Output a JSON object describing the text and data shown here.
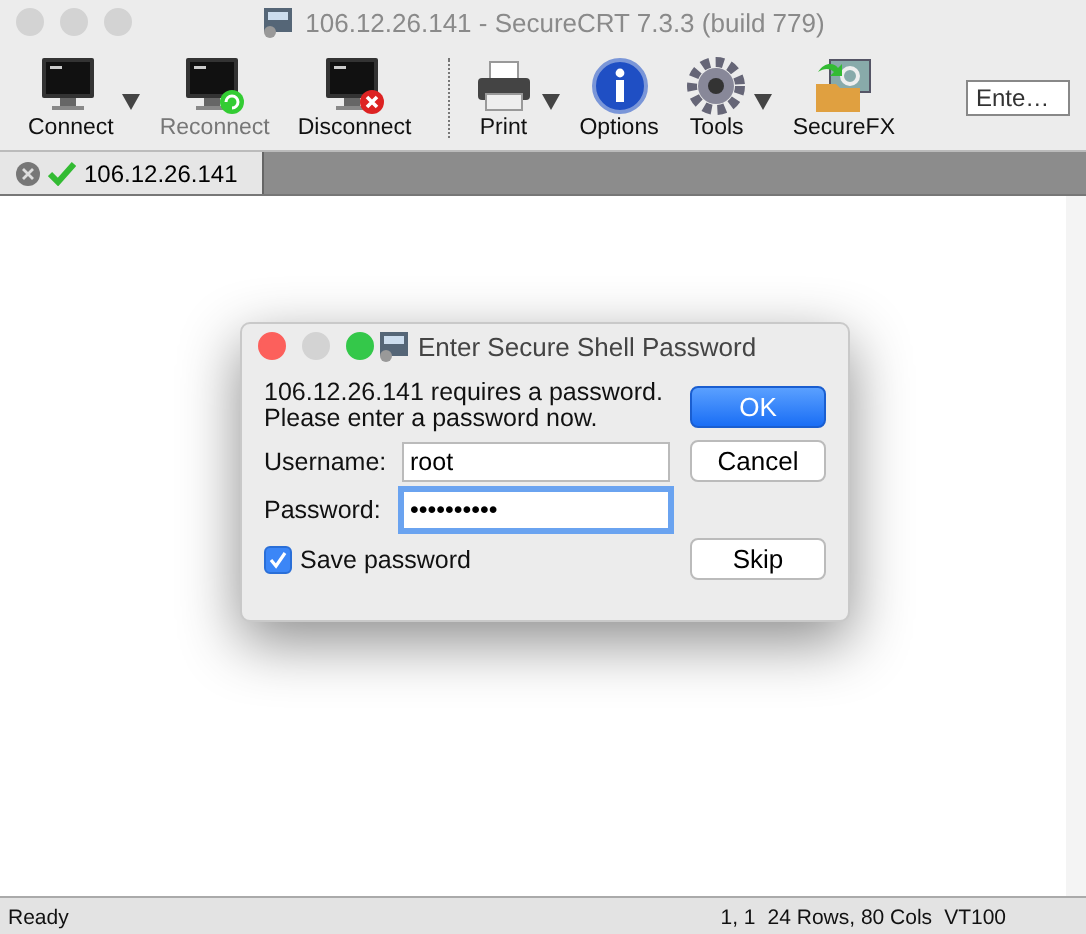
{
  "window": {
    "title": "106.12.26.141 - SecureCRT 7.3.3 (build 779)"
  },
  "toolbar": {
    "items": [
      {
        "kind": "connect",
        "label": "Connect",
        "dropdown": true,
        "disabled": false,
        "separator_after": false
      },
      {
        "kind": "reconnect",
        "label": "Reconnect",
        "dropdown": false,
        "disabled": true,
        "separator_after": false
      },
      {
        "kind": "disconnect",
        "label": "Disconnect",
        "dropdown": false,
        "disabled": false,
        "separator_after": true
      },
      {
        "kind": "print",
        "label": "Print",
        "dropdown": true,
        "disabled": false,
        "separator_after": false
      },
      {
        "kind": "options",
        "label": "Options",
        "dropdown": false,
        "disabled": false,
        "separator_after": false
      },
      {
        "kind": "tools",
        "label": "Tools",
        "dropdown": true,
        "disabled": false,
        "separator_after": false
      },
      {
        "kind": "securefx",
        "label": "SecureFX",
        "dropdown": false,
        "disabled": false,
        "separator_after": false
      }
    ],
    "search": {
      "placeholder": "Ente…"
    }
  },
  "tabs": [
    {
      "label": "106.12.26.141",
      "selected": true,
      "connected": true
    }
  ],
  "dialog": {
    "title": "Enter Secure Shell Password",
    "message": "106.12.26.141 requires a password.\nPlease enter a password now.",
    "fields": [
      {
        "label": "Username:",
        "value": "root",
        "focused": false
      },
      {
        "label": "Password:",
        "value": "••••••••••",
        "focused": true
      }
    ],
    "save_password": {
      "label": "Save password",
      "checked": true
    },
    "buttons": [
      {
        "label": "OK",
        "default": true
      },
      {
        "label": "Cancel",
        "default": false
      },
      {
        "label": "Skip",
        "default": false
      }
    ]
  },
  "status_bar": {
    "left": "Ready",
    "position": "1, 1",
    "size": "24 Rows, 80 Cols",
    "terminal": "VT100"
  }
}
